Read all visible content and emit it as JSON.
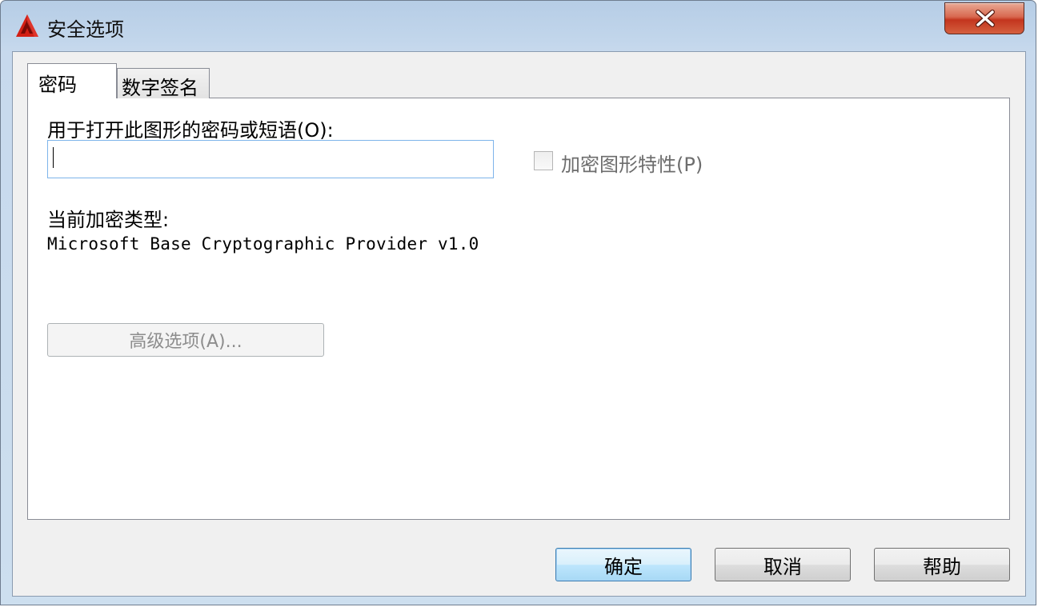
{
  "window": {
    "title": "安全选项",
    "app_icon": "autocad-logo-icon",
    "close_icon": "close-icon"
  },
  "tabs": [
    {
      "label": "密码",
      "selected": true
    },
    {
      "label": "数字签名",
      "selected": false
    }
  ],
  "password_tab": {
    "password_label": "用于打开此图形的密码或短语(O):",
    "password_value": "",
    "encrypt_properties": {
      "label": "加密图形特性(P)",
      "checked": false,
      "enabled": false
    },
    "encryption_type_label": "当前加密类型:",
    "encryption_type_value": "Microsoft Base Cryptographic Provider v1.0",
    "advanced_button": "高级选项(A)..."
  },
  "buttons": {
    "ok": "确定",
    "cancel": "取消",
    "help": "帮助"
  },
  "colors": {
    "title_gradient": "#c2d6eb",
    "close_red": "#c3351e",
    "focus_blue": "#7eb4ea"
  }
}
